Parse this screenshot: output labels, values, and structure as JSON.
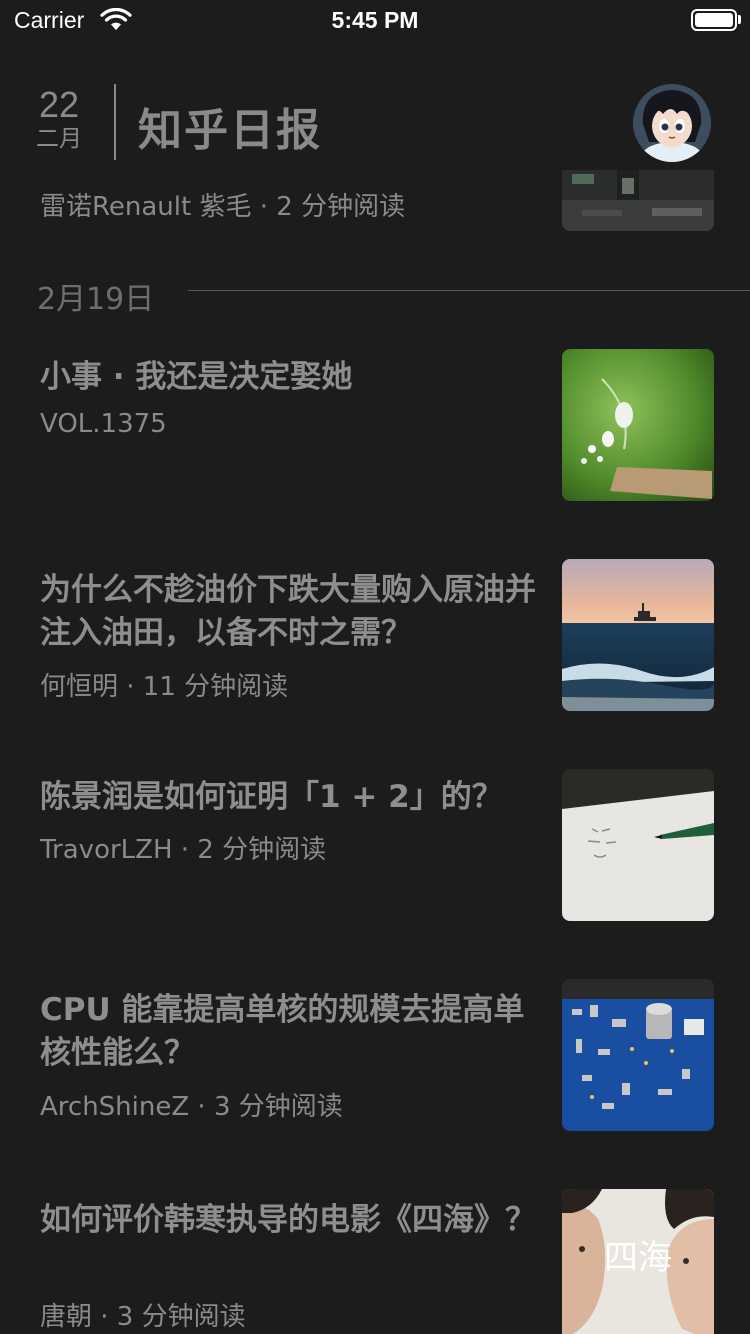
{
  "status_bar": {
    "carrier": "Carrier",
    "time": "5:45 PM"
  },
  "header": {
    "day": "22",
    "month": "二月",
    "title": "知乎日报"
  },
  "partial_item": {
    "meta": "雷诺Renault 紫毛 · 2 分钟阅读"
  },
  "section": {
    "date": "2月19日"
  },
  "articles": [
    {
      "title": "小事 · 我还是决定娶她",
      "meta": "VOL.1375"
    },
    {
      "title": "为什么不趁油价下跌大量购入原油并注入油田，以备不时之需？",
      "meta": "何恒明 · 11 分钟阅读"
    },
    {
      "title": "陈景润是如何证明「1 + 2」的？",
      "meta": "TravorLZH · 2 分钟阅读"
    },
    {
      "title": "CPU 能靠提高单核的规模去提高单核性能么？",
      "meta": "ArchShineZ · 3 分钟阅读"
    },
    {
      "title": "如何评价韩寒执导的电影《四海》？",
      "meta": "唐朝 · 3 分钟阅读"
    }
  ],
  "thumb_text": {
    "poster": "四海"
  },
  "colors": {
    "background": "#1c1c1c",
    "text": "#8e8e8e",
    "status_text": "#ffffff"
  }
}
